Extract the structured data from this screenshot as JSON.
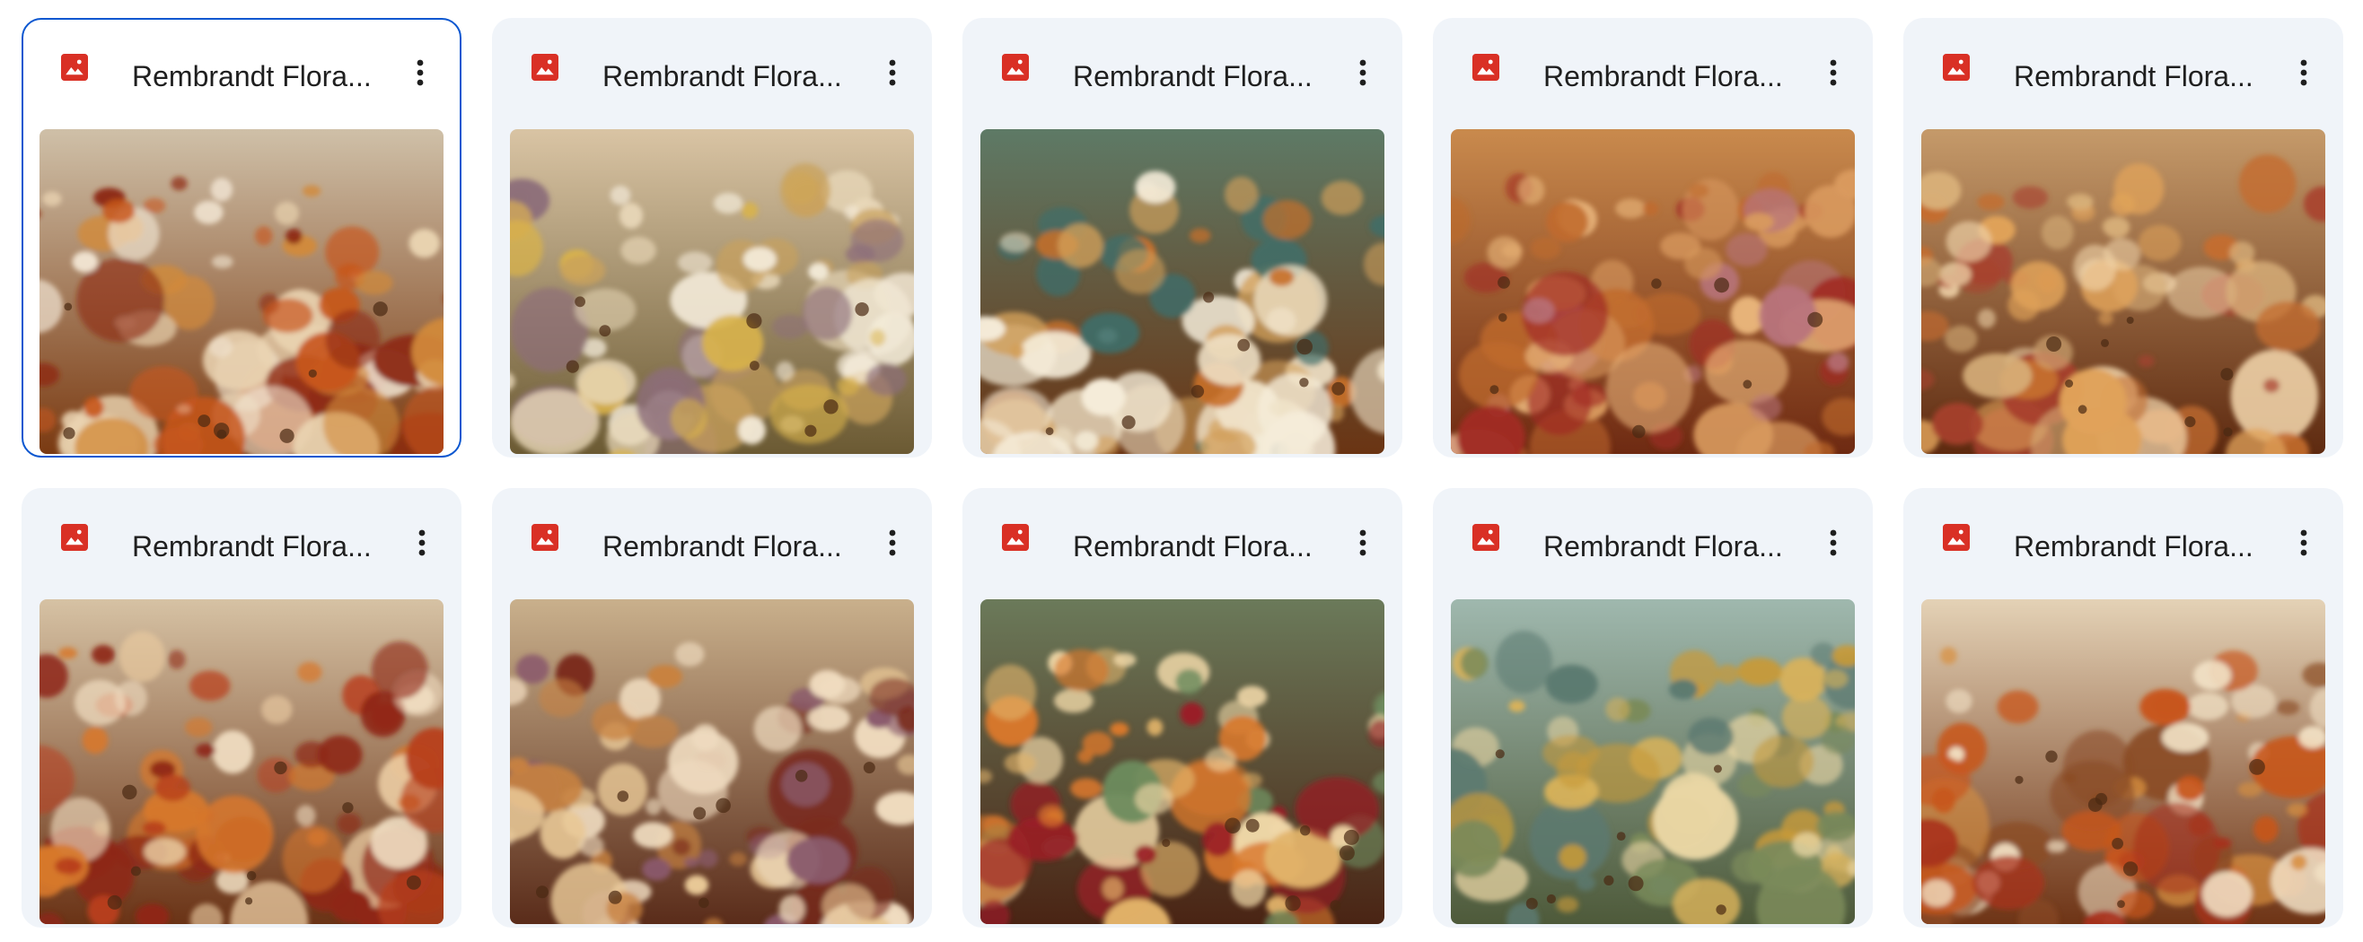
{
  "files": [
    {
      "name": "Rembrandt Flora...",
      "icon": "image-file-icon",
      "selected": true,
      "palette": {
        "bg1": "#cfc0a8",
        "bg2": "#7a3a12",
        "accents": [
          "#c8561b",
          "#e9d3b0",
          "#8e2a14",
          "#d28a3a",
          "#f2e6d4"
        ]
      }
    },
    {
      "name": "Rembrandt Flora...",
      "icon": "image-file-icon",
      "selected": false,
      "palette": {
        "bg1": "#d9c4a4",
        "bg2": "#6b5a33",
        "accents": [
          "#e8d7b8",
          "#c9a15c",
          "#8d6e7a",
          "#d9b34a",
          "#f3ead8"
        ]
      }
    },
    {
      "name": "Rembrandt Flora...",
      "icon": "image-file-icon",
      "selected": false,
      "palette": {
        "bg1": "#5e7a66",
        "bg2": "#6a3413",
        "accents": [
          "#efe1c6",
          "#d3a05a",
          "#c8702a",
          "#3e6e6a",
          "#f5ecd9"
        ]
      }
    },
    {
      "name": "Rembrandt Flora...",
      "icon": "image-file-icon",
      "selected": false,
      "palette": {
        "bg1": "#c98a4d",
        "bg2": "#6e2a12",
        "accents": [
          "#a12a24",
          "#d99a5e",
          "#e8b47a",
          "#c06a2c",
          "#b8747c"
        ]
      }
    },
    {
      "name": "Rembrandt Flora...",
      "icon": "image-file-icon",
      "selected": false,
      "palette": {
        "bg1": "#c59a6a",
        "bg2": "#5e2a10",
        "accents": [
          "#e0a25a",
          "#a8402e",
          "#d8b07a",
          "#c46d2f",
          "#efd2a8"
        ]
      }
    },
    {
      "name": "Rembrandt Flora...",
      "icon": "image-file-icon",
      "selected": false,
      "palette": {
        "bg1": "#d6c2a4",
        "bg2": "#6a3316",
        "accents": [
          "#b8401c",
          "#efdcc0",
          "#d7782c",
          "#8e2616",
          "#e8c9a0"
        ]
      }
    },
    {
      "name": "Rembrandt Flora...",
      "icon": "image-file-icon",
      "selected": false,
      "palette": {
        "bg1": "#c9b08c",
        "bg2": "#5a2c1a",
        "accents": [
          "#e8c896",
          "#8a5a6c",
          "#c88240",
          "#7a2a1c",
          "#f0dcc0"
        ]
      }
    },
    {
      "name": "Rembrandt Flora...",
      "icon": "image-file-icon",
      "selected": false,
      "palette": {
        "bg1": "#6b7a5a",
        "bg2": "#4a2414",
        "accents": [
          "#e2b46a",
          "#9a1f26",
          "#d9782c",
          "#f0d8a8",
          "#6e8c5e"
        ]
      }
    },
    {
      "name": "Rembrandt Flora...",
      "icon": "image-file-icon",
      "selected": false,
      "palette": {
        "bg1": "#9fb8ae",
        "bg2": "#4e5a3a",
        "accents": [
          "#d9b25a",
          "#e9d6a4",
          "#7a8a5a",
          "#c79a3a",
          "#5c7a70"
        ]
      }
    },
    {
      "name": "Rembrandt Flora...",
      "icon": "image-file-icon",
      "selected": false,
      "palette": {
        "bg1": "#e4d2b6",
        "bg2": "#6e3416",
        "accents": [
          "#c8561b",
          "#f2e2c6",
          "#a8301c",
          "#d89040",
          "#8a4a24"
        ]
      }
    }
  ],
  "colors": {
    "accent": "#0b57d0",
    "icon_red": "#d93025",
    "card_bg": "#f0f4f9"
  }
}
